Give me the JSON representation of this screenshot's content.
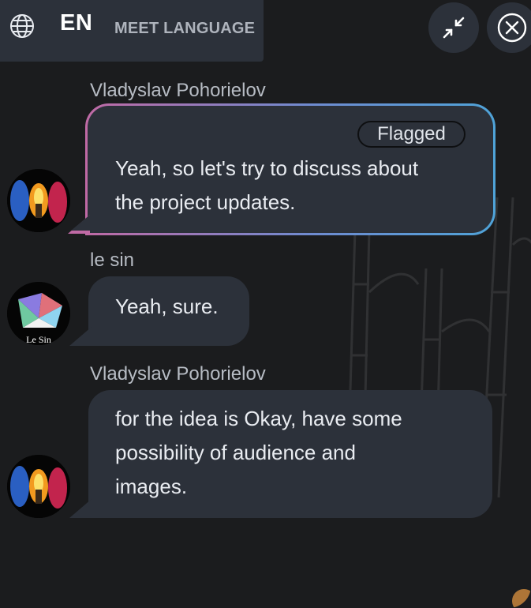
{
  "header": {
    "lang_code": "EN",
    "lang_label": "MEET LANGUAGE",
    "icons": {
      "globe": "globe-icon",
      "minimize": "minimize-arrows-icon",
      "close": "close-circle-icon"
    }
  },
  "messages": [
    {
      "sender": "Vladyslav Pohorielov",
      "badge": "Flagged",
      "lines": [
        "Yeah, so let's try to discuss about",
        "the project updates."
      ],
      "avatar": "fire-figure-avatar"
    },
    {
      "sender": "le sin",
      "lines": [
        "Yeah, sure."
      ],
      "avatar": "le-sin-logo-avatar",
      "avatar_text": "Le Sin"
    },
    {
      "sender": "Vladyslav Pohorielov",
      "lines": [
        "for the idea is Okay, have some",
        "possibility of audience and",
        "images."
      ],
      "avatar": "fire-figure-avatar"
    }
  ],
  "colors": {
    "background": "#1b1c1e",
    "bubble": "#2c313a",
    "flag_gradient": [
      "#c06aa5",
      "#4fa3d8"
    ]
  }
}
